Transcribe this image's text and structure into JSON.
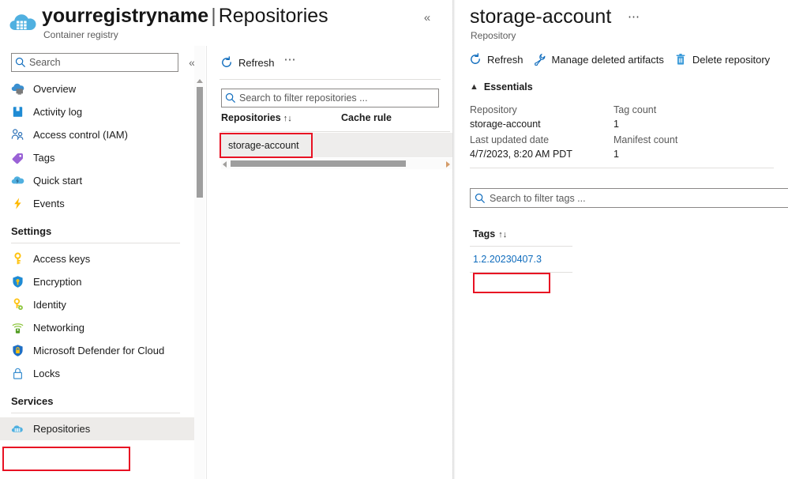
{
  "resource": {
    "icon": "container-registry-icon",
    "registry_name": "yourregistryname",
    "separator": "|",
    "sub_page": "Repositories",
    "subtitle": "Container registry",
    "collapse_icon": "chevron-double-left-icon"
  },
  "menu": {
    "search_placeholder": "Search",
    "search_icon": "search-icon",
    "collapse_icon": "chevron-double-left-icon",
    "items": [
      {
        "label": "Overview",
        "icon": "overview-cloud-icon",
        "selected": false
      },
      {
        "label": "Activity log",
        "icon": "activity-log-icon",
        "selected": false
      },
      {
        "label": "Access control (IAM)",
        "icon": "access-control-people-icon",
        "selected": false
      },
      {
        "label": "Tags",
        "icon": "tag-icon",
        "selected": false
      },
      {
        "label": "Quick start",
        "icon": "quick-start-icon",
        "selected": false
      },
      {
        "label": "Events",
        "icon": "events-lightning-icon",
        "selected": false
      }
    ],
    "groups": [
      {
        "label": "Settings",
        "items": [
          {
            "label": "Access keys",
            "icon": "key-icon",
            "selected": false
          },
          {
            "label": "Encryption",
            "icon": "encryption-shield-icon",
            "selected": false
          },
          {
            "label": "Identity",
            "icon": "identity-key-icon",
            "selected": false
          },
          {
            "label": "Networking",
            "icon": "networking-icon",
            "selected": false
          },
          {
            "label": "Microsoft Defender for Cloud",
            "icon": "defender-shield-icon",
            "selected": false
          },
          {
            "label": "Locks",
            "icon": "lock-icon",
            "selected": false
          }
        ]
      },
      {
        "label": "Services",
        "items": [
          {
            "label": "Repositories",
            "icon": "repositories-icon",
            "selected": true
          }
        ]
      }
    ]
  },
  "repositories_panel": {
    "refresh_label": "Refresh",
    "refresh_icon": "refresh-icon",
    "more_icon": "ellipsis-icon",
    "search_placeholder": "Search to filter repositories ...",
    "search_icon": "search-icon",
    "columns": [
      {
        "label": "Repositories",
        "sort": "↑↓"
      },
      {
        "label": "Cache rule",
        "sort": ""
      }
    ],
    "rows": [
      {
        "name": "storage-account",
        "cache_rule": "",
        "selected": true
      }
    ],
    "scroll": {
      "left_arrow_icon": "scroll-left-arrow-icon",
      "right_arrow_icon": "scroll-right-arrow-icon"
    }
  },
  "repository_blade": {
    "title": "storage-account",
    "more_icon": "ellipsis-icon",
    "subtitle": "Repository",
    "toolbar": [
      {
        "label": "Refresh",
        "icon": "refresh-icon"
      },
      {
        "label": "Manage deleted artifacts",
        "icon": "wrench-icon"
      },
      {
        "label": "Delete repository",
        "icon": "trash-icon"
      }
    ],
    "essentials": {
      "header": "Essentials",
      "collapse_icon": "chevron-up-icon",
      "fields": [
        {
          "key": "Repository",
          "value": "storage-account"
        },
        {
          "key": "Tag count",
          "value": "1"
        },
        {
          "key": "Last updated date",
          "value": "4/7/2023, 8:20 AM PDT"
        },
        {
          "key": "Manifest count",
          "value": "1"
        }
      ]
    },
    "tags_search_placeholder": "Search to filter tags ...",
    "tags_search_icon": "search-icon",
    "tags_column": {
      "label": "Tags",
      "sort": "↑↓"
    },
    "tags": [
      {
        "name": "1.2.20230407.3"
      }
    ]
  },
  "annotations": {
    "color": "#e81123",
    "boxes": [
      {
        "name": "repositories-nav",
        "target": "Repositories"
      },
      {
        "name": "storage-account-row",
        "target": "storage-account"
      },
      {
        "name": "tag-link",
        "target": "1.2.20230407.3"
      }
    ]
  }
}
